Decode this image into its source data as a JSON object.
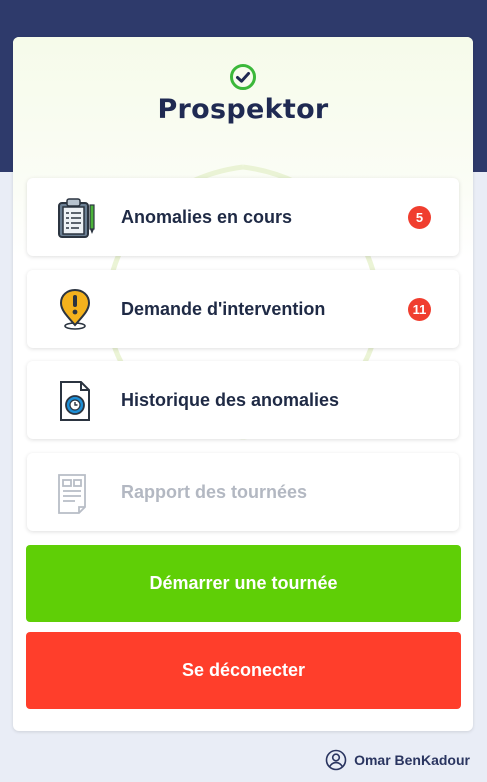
{
  "app": {
    "title": "Prospektor"
  },
  "menu": [
    {
      "label": "Anomalies en cours",
      "badge": "5",
      "icon": "clipboard-icon",
      "enabled": true
    },
    {
      "label": "Demande d'intervention",
      "badge": "11",
      "icon": "location-pin-alert-icon",
      "enabled": true
    },
    {
      "label": "Historique des anomalies",
      "icon": "document-clock-icon",
      "enabled": true
    },
    {
      "label": "Rapport des tournées",
      "icon": "report-icon",
      "enabled": false
    }
  ],
  "actions": {
    "start": "Démarrer une tournée",
    "logout": "Se déconecter"
  },
  "user": {
    "name": "Omar BenKadour",
    "icon": "user-icon"
  },
  "colors": {
    "header": "#2e3a6b",
    "start": "#5fcf06",
    "logout": "#ff3e2b",
    "badge": "#f03e2f",
    "logo_check": "#3bb83a"
  }
}
